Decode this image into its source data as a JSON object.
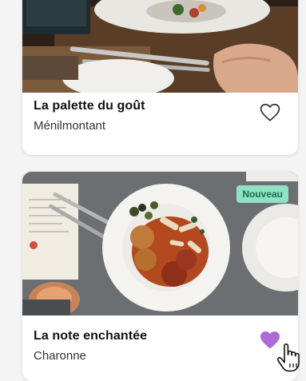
{
  "restaurants": [
    {
      "name": "La palette du goût",
      "location": "Ménilmontant",
      "favorited": false
    },
    {
      "name": "La note enchantée",
      "location": "Charonne",
      "favorited": true,
      "badge": "Nouveau"
    }
  ],
  "colors": {
    "badge_bg": "#8fe3c4",
    "badge_text": "#1d6d4f",
    "heart_active": "#b06ad6",
    "heart_outline": "#333333"
  },
  "icons": {
    "favorite": "heart-icon",
    "cursor": "hand-pointer-icon"
  }
}
